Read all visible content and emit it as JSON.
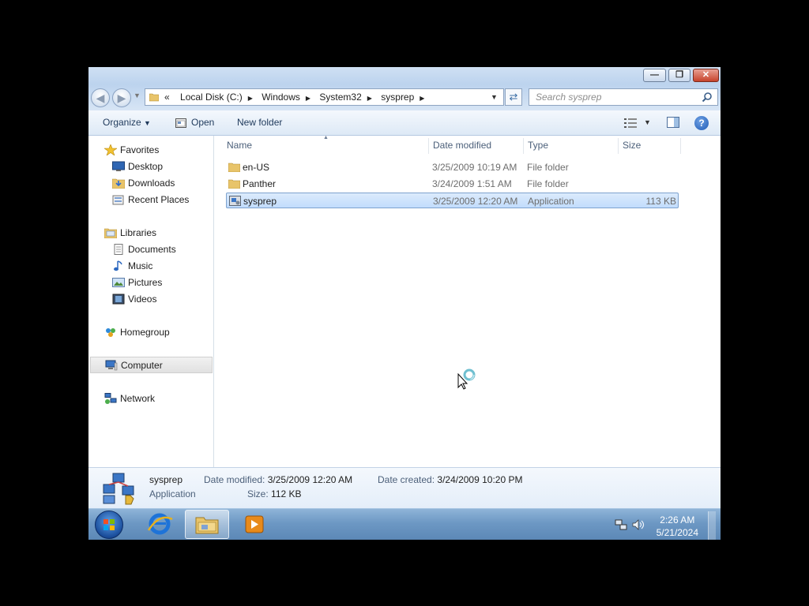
{
  "window": {
    "controls": {
      "minimize": "minimize-icon",
      "maximize": "restore-icon",
      "close": "close-icon"
    }
  },
  "address": {
    "overflow": "«",
    "crumbs": [
      "Local Disk (C:)",
      "Windows",
      "System32",
      "sysprep"
    ],
    "search_placeholder": "Search sysprep"
  },
  "toolbar": {
    "organize": "Organize",
    "open": "Open",
    "new_folder": "New folder"
  },
  "nav": {
    "favorites": "Favorites",
    "desktop": "Desktop",
    "downloads": "Downloads",
    "recent": "Recent Places",
    "libraries": "Libraries",
    "documents": "Documents",
    "music": "Music",
    "pictures": "Pictures",
    "videos": "Videos",
    "homegroup": "Homegroup",
    "computer": "Computer",
    "network": "Network"
  },
  "columns": {
    "name": "Name",
    "date": "Date modified",
    "type": "Type",
    "size": "Size"
  },
  "files": [
    {
      "name": "en-US",
      "date": "3/25/2009 10:19 AM",
      "type": "File folder",
      "size": ""
    },
    {
      "name": "Panther",
      "date": "3/24/2009 1:51 AM",
      "type": "File folder",
      "size": ""
    },
    {
      "name": "sysprep",
      "date": "3/25/2009 12:20 AM",
      "type": "Application",
      "size": "113 KB"
    }
  ],
  "details": {
    "name": "sysprep",
    "type": "Application",
    "modified_label": "Date modified:",
    "modified": "3/25/2009 12:20 AM",
    "created_label": "Date created:",
    "created": "3/24/2009 10:20 PM",
    "size_label": "Size:",
    "size": "112 KB"
  },
  "taskbar": {
    "time": "2:26 AM",
    "date": "5/21/2024"
  },
  "colors": {
    "selection": "#c1dcfc",
    "taskbar": "#6d98c4",
    "accent": "#1e395b"
  }
}
